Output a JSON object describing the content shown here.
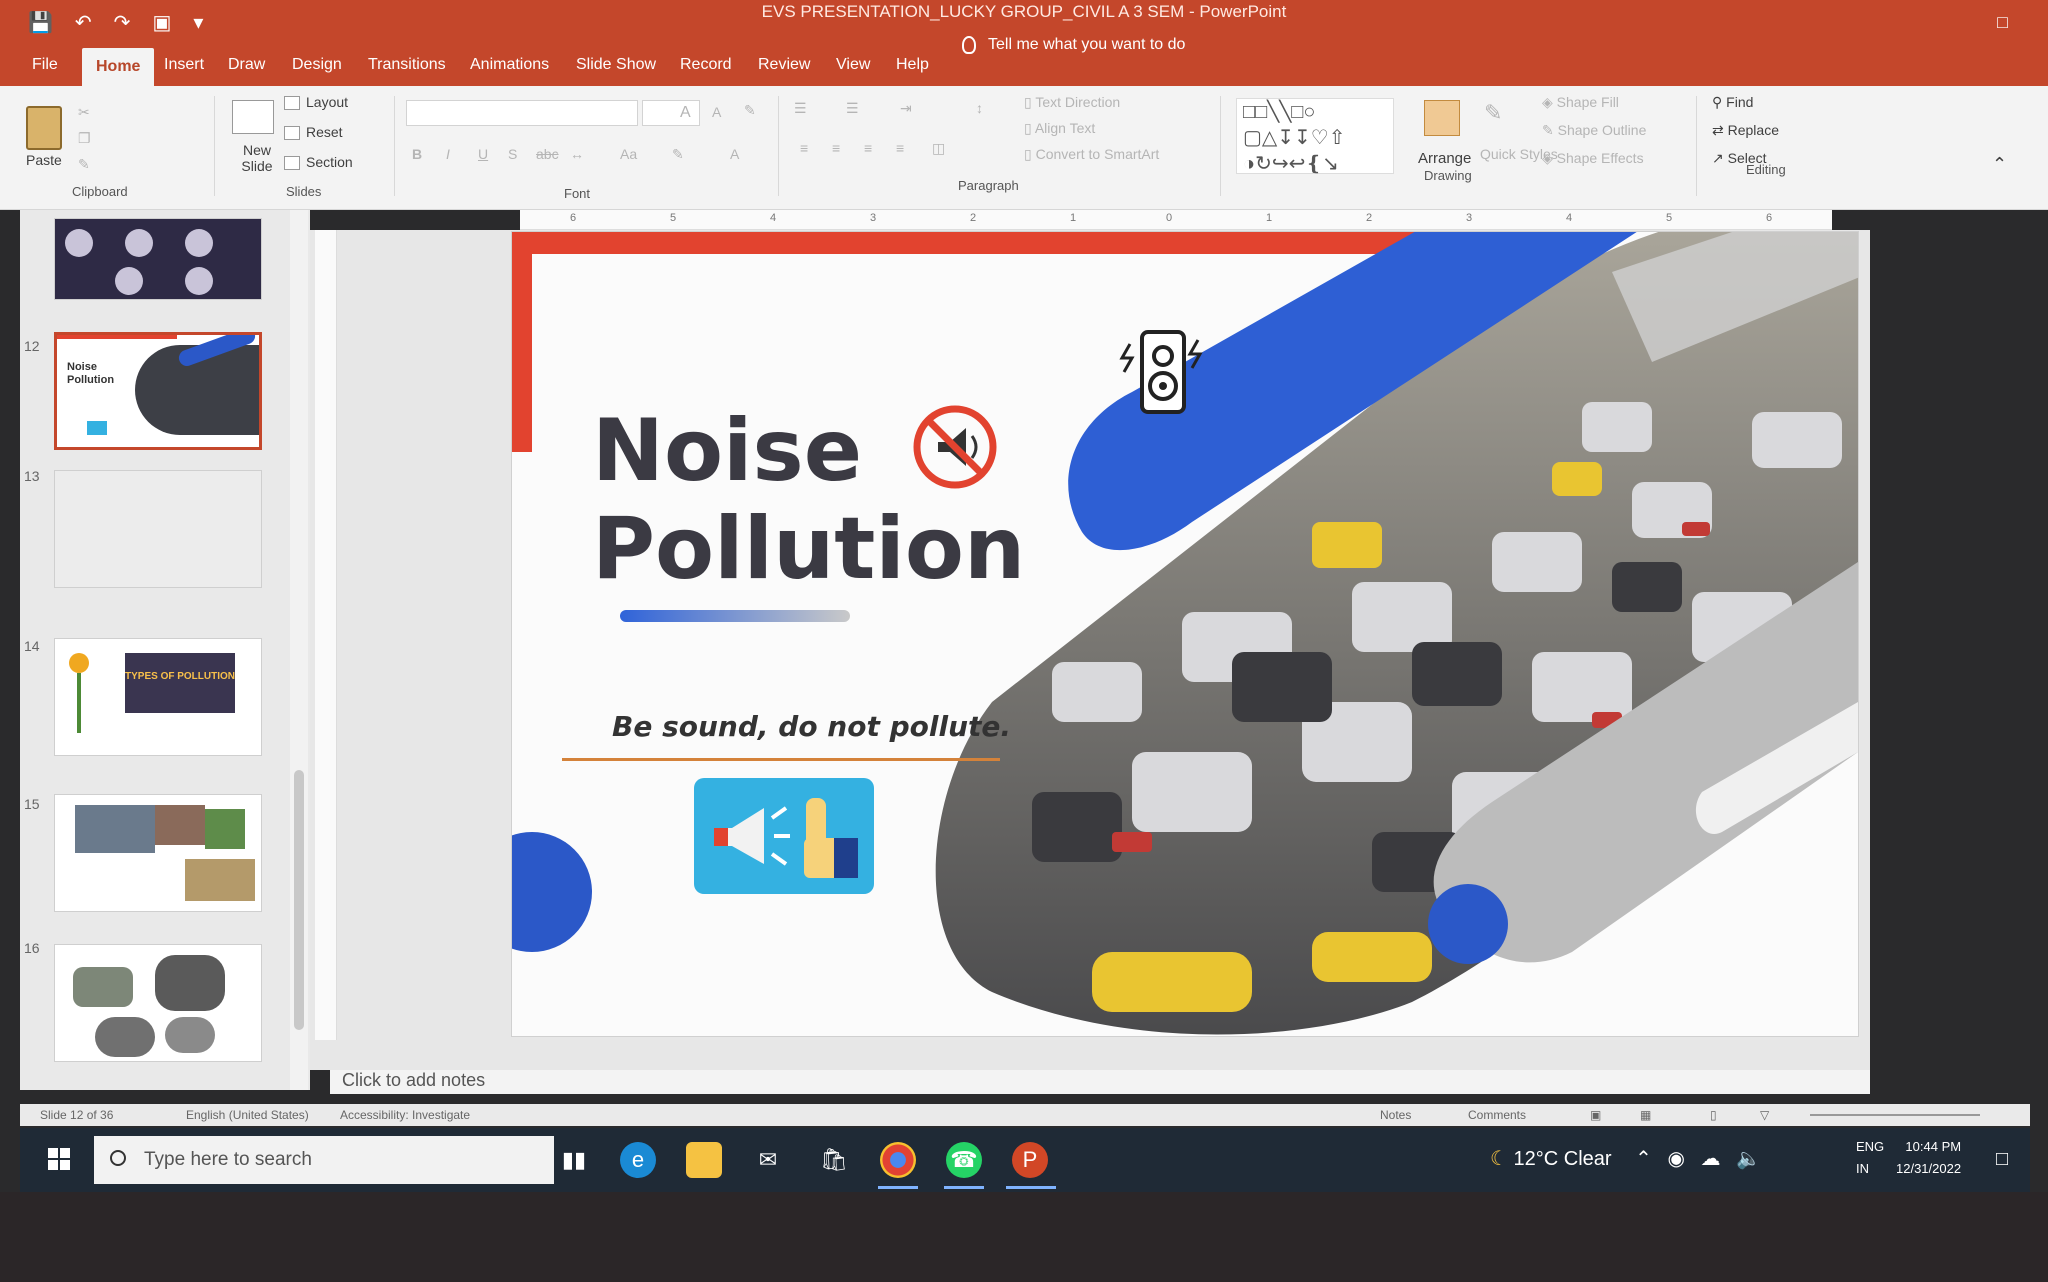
{
  "window": {
    "title": "EVS PRESENTATION_LUCKY GROUP_CIVIL A 3 SEM  -  PowerPoint"
  },
  "tabs": [
    "File",
    "Home",
    "Insert",
    "Draw",
    "Design",
    "Transitions",
    "Animations",
    "Slide Show",
    "Record",
    "Review",
    "View",
    "Help"
  ],
  "active_tab": "Home",
  "tell_me": "Tell me what you want to do",
  "ribbon": {
    "clipboard": {
      "paste": "Paste",
      "label": "Clipboard"
    },
    "slides": {
      "new_slide": "New Slide",
      "layout": "Layout",
      "reset": "Reset",
      "section": "Section",
      "label": "Slides"
    },
    "font": {
      "label": "Font"
    },
    "paragraph": {
      "label": "Paragraph"
    },
    "drawing": {
      "arrange": "Arrange",
      "label": "Drawing"
    },
    "editing": {
      "find": "Find",
      "replace": "Replace",
      "select": "Select",
      "label": "Editing"
    }
  },
  "ruler_ticks": [
    "6",
    "5",
    "4",
    "3",
    "2",
    "1",
    "0",
    "1",
    "2",
    "3",
    "4",
    "5",
    "6"
  ],
  "slide_panel": {
    "thumbnails": [
      {
        "number": "",
        "label": ""
      },
      {
        "number": "12",
        "label": "Noise Pollution"
      },
      {
        "number": "13",
        "label": ""
      },
      {
        "number": "14",
        "label": "TYPES OF POLLUTION"
      },
      {
        "number": "15",
        "label": ""
      },
      {
        "number": "16",
        "label": ""
      }
    ]
  },
  "slide": {
    "title_line1": "Noise",
    "title_line2": "Pollution",
    "tagline": "Be sound, do not pollute."
  },
  "notes_placeholder": "Click to add notes",
  "status": {
    "slide_count": "Slide 12 of 36",
    "language": "English (United States)",
    "accessibility": "Accessibility: Investigate",
    "notes": "Notes",
    "comments": "Comments"
  },
  "taskbar": {
    "search_placeholder": "Type here to search",
    "weather": "12°C  Clear",
    "lang_top": "ENG",
    "lang_bottom": "IN",
    "time": "10:44 PM",
    "date": "12/31/2022"
  },
  "colors": {
    "accent": "#c4472b",
    "slide_red": "#e2432f",
    "slide_blue": "#2b58c8",
    "taskbar": "#1f2a36"
  }
}
